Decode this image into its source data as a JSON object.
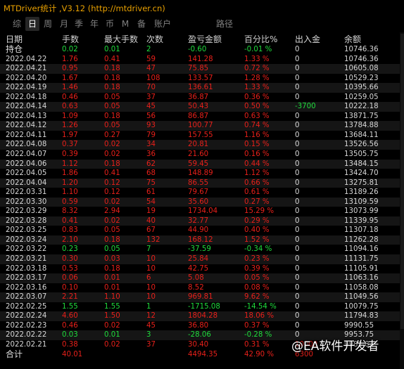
{
  "window": {
    "title": "MTDriver统计 ,V3.12 (http://mtdriver.cn)"
  },
  "tabs": [
    "综",
    "日",
    "周",
    "月",
    "季",
    "年",
    "币",
    "M",
    "备",
    "账户",
    "路径"
  ],
  "active_tab": "日",
  "columns": [
    "日期",
    "手数",
    "最大手数",
    "次数",
    "盈亏金额",
    "百分比%",
    "出入金",
    "余额"
  ],
  "position_row": {
    "label": "持仓",
    "lots": "0.02",
    "max_lots": "0.01",
    "count": "2",
    "pl": "-0.60",
    "pct": "-0.01 %",
    "io": "0",
    "balance": "10746.36"
  },
  "rows": [
    {
      "date": "2022.04.22",
      "lots": "1.76",
      "max_lots": "0.41",
      "count": "59",
      "pl": "141.28",
      "pct": "1.33 %",
      "io": "0",
      "balance": "10746.36"
    },
    {
      "date": "2022.04.21",
      "lots": "0.95",
      "max_lots": "0.18",
      "count": "47",
      "pl": "75.85",
      "pct": "0.72 %",
      "io": "0",
      "balance": "10605.08"
    },
    {
      "date": "2022.04.20",
      "lots": "1.67",
      "max_lots": "0.18",
      "count": "108",
      "pl": "133.57",
      "pct": "1.28 %",
      "io": "0",
      "balance": "10529.23"
    },
    {
      "date": "2022.04.19",
      "lots": "1.46",
      "max_lots": "0.18",
      "count": "70",
      "pl": "136.61",
      "pct": "1.33 %",
      "io": "0",
      "balance": "10395.66"
    },
    {
      "date": "2022.04.18",
      "lots": "0.46",
      "max_lots": "0.05",
      "count": "37",
      "pl": "36.87",
      "pct": "0.36 %",
      "io": "0",
      "balance": "10259.05"
    },
    {
      "date": "2022.04.14",
      "lots": "0.63",
      "max_lots": "0.05",
      "count": "45",
      "pl": "50.43",
      "pct": "0.50 %",
      "io": "-3700",
      "balance": "10222.18"
    },
    {
      "date": "2022.04.13",
      "lots": "1.09",
      "max_lots": "0.18",
      "count": "56",
      "pl": "86.87",
      "pct": "0.63 %",
      "io": "0",
      "balance": "13871.75"
    },
    {
      "date": "2022.04.12",
      "lots": "1.26",
      "max_lots": "0.05",
      "count": "93",
      "pl": "100.77",
      "pct": "0.74 %",
      "io": "0",
      "balance": "13784.88"
    },
    {
      "date": "2022.04.11",
      "lots": "1.97",
      "max_lots": "0.27",
      "count": "79",
      "pl": "157.55",
      "pct": "1.16 %",
      "io": "0",
      "balance": "13684.11"
    },
    {
      "date": "2022.04.08",
      "lots": "0.37",
      "max_lots": "0.02",
      "count": "34",
      "pl": "20.81",
      "pct": "0.15 %",
      "io": "0",
      "balance": "13526.56"
    },
    {
      "date": "2022.04.07",
      "lots": "0.39",
      "max_lots": "0.02",
      "count": "36",
      "pl": "21.60",
      "pct": "0.16 %",
      "io": "0",
      "balance": "13505.75"
    },
    {
      "date": "2022.04.06",
      "lots": "1.12",
      "max_lots": "0.18",
      "count": "62",
      "pl": "59.45",
      "pct": "0.44 %",
      "io": "0",
      "balance": "13484.15"
    },
    {
      "date": "2022.04.05",
      "lots": "1.86",
      "max_lots": "0.41",
      "count": "68",
      "pl": "148.89",
      "pct": "1.12 %",
      "io": "0",
      "balance": "13424.70"
    },
    {
      "date": "2022.04.04",
      "lots": "1.20",
      "max_lots": "0.12",
      "count": "75",
      "pl": "86.55",
      "pct": "0.66 %",
      "io": "0",
      "balance": "13275.81"
    },
    {
      "date": "2022.03.31",
      "lots": "1.10",
      "max_lots": "0.12",
      "count": "61",
      "pl": "79.67",
      "pct": "0.61 %",
      "io": "0",
      "balance": "13189.26"
    },
    {
      "date": "2022.03.30",
      "lots": "0.59",
      "max_lots": "0.02",
      "count": "54",
      "pl": "35.60",
      "pct": "0.27 %",
      "io": "0",
      "balance": "13109.59"
    },
    {
      "date": "2022.03.29",
      "lots": "8.32",
      "max_lots": "2.94",
      "count": "19",
      "pl": "1734.04",
      "pct": "15.29 %",
      "io": "0",
      "balance": "13073.99"
    },
    {
      "date": "2022.03.28",
      "lots": "0.41",
      "max_lots": "0.02",
      "count": "40",
      "pl": "32.77",
      "pct": "0.29 %",
      "io": "0",
      "balance": "11339.95"
    },
    {
      "date": "2022.03.25",
      "lots": "0.83",
      "max_lots": "0.05",
      "count": "67",
      "pl": "44.90",
      "pct": "0.40 %",
      "io": "0",
      "balance": "11307.18"
    },
    {
      "date": "2022.03.24",
      "lots": "2.10",
      "max_lots": "0.18",
      "count": "132",
      "pl": "168.12",
      "pct": "1.52 %",
      "io": "0",
      "balance": "11262.28"
    },
    {
      "date": "2022.03.22",
      "lots": "0.23",
      "max_lots": "0.05",
      "count": "7",
      "pl": "-37.59",
      "pct": "-0.34 %",
      "io": "0",
      "balance": "11094.16"
    },
    {
      "date": "2022.03.21",
      "lots": "0.30",
      "max_lots": "0.03",
      "count": "10",
      "pl": "25.84",
      "pct": "0.23 %",
      "io": "0",
      "balance": "11131.75"
    },
    {
      "date": "2022.03.18",
      "lots": "0.53",
      "max_lots": "0.18",
      "count": "10",
      "pl": "42.75",
      "pct": "0.39 %",
      "io": "0",
      "balance": "11105.91"
    },
    {
      "date": "2022.03.17",
      "lots": "0.06",
      "max_lots": "0.01",
      "count": "6",
      "pl": "5.08",
      "pct": "0.05 %",
      "io": "0",
      "balance": "11063.16"
    },
    {
      "date": "2022.03.16",
      "lots": "0.10",
      "max_lots": "0.01",
      "count": "10",
      "pl": "8.52",
      "pct": "0.08 %",
      "io": "0",
      "balance": "11058.08"
    },
    {
      "date": "2022.03.07",
      "lots": "2.21",
      "max_lots": "1.10",
      "count": "10",
      "pl": "969.81",
      "pct": "9.62 %",
      "io": "0",
      "balance": "11049.56"
    },
    {
      "date": "2022.02.25",
      "lots": "1.55",
      "max_lots": "1.55",
      "count": "1",
      "pl": "-1715.08",
      "pct": "-14.54 %",
      "io": "0",
      "balance": "10079.75"
    },
    {
      "date": "2022.02.24",
      "lots": "4.60",
      "max_lots": "1.50",
      "count": "12",
      "pl": "1804.28",
      "pct": "18.06 %",
      "io": "0",
      "balance": "11794.83"
    },
    {
      "date": "2022.02.23",
      "lots": "0.46",
      "max_lots": "0.02",
      "count": "45",
      "pl": "36.80",
      "pct": "0.37 %",
      "io": "0",
      "balance": "9990.55"
    },
    {
      "date": "2022.02.22",
      "lots": "0.03",
      "max_lots": "0.01",
      "count": "3",
      "pl": "-28.06",
      "pct": "-0.28 %",
      "io": "0",
      "balance": "9953.75"
    },
    {
      "date": "2022.02.21",
      "lots": "0.38",
      "max_lots": "0.02",
      "count": "37",
      "pl": "30.40",
      "pct": "0.31 %",
      "io": "10000",
      "balance": "9981.81"
    }
  ],
  "total_row": {
    "label": "合计",
    "lots": "40.01",
    "max_lots": "",
    "count": "",
    "pl": "4494.35",
    "pct": "42.90 %",
    "io": "6300",
    "balance": ""
  },
  "watermark": "@EA软件开发者",
  "colors": {
    "title": "#e8a000",
    "positive": "#e8201a",
    "negative": "#1fdc3c",
    "background": "#000000"
  }
}
